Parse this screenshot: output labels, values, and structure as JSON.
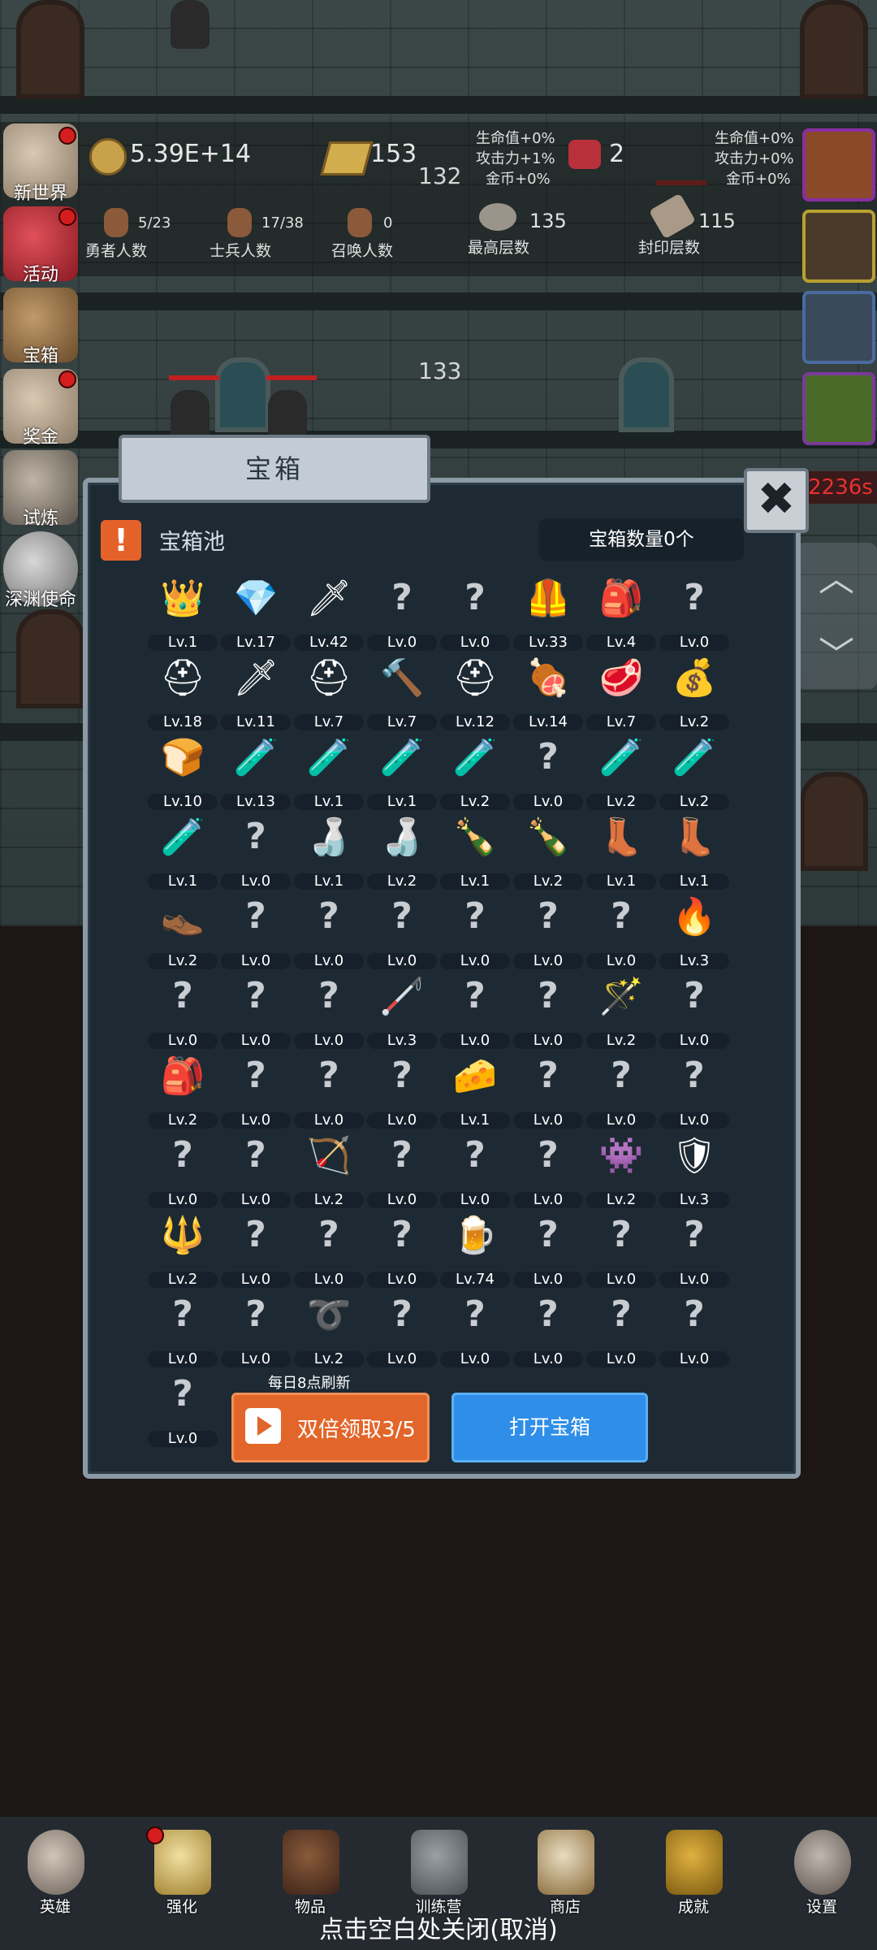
{
  "resources": {
    "gold": "5.39E+14",
    "bars": "153",
    "gems": "2",
    "mid_number": "132",
    "bonus_left": [
      "生命值+0%",
      "攻击力+1%",
      "金币+0%"
    ],
    "bonus_right": [
      "生命值+0%",
      "攻击力+0%",
      "金币+0%"
    ]
  },
  "counts": {
    "heroes_value": "5/23",
    "heroes_label": "勇者人数",
    "soldiers_value": "17/38",
    "soldiers_label": "士兵人数",
    "summon_value": "0",
    "summon_label": "召唤人数",
    "highest_value": "135",
    "highest_label": "最高层数",
    "sealed_value": "115",
    "sealed_label": "封印层数"
  },
  "floor_number": "133",
  "timer": "2236s",
  "sidebar": [
    {
      "label": "新世界"
    },
    {
      "label": "活动"
    },
    {
      "label": "宝箱"
    },
    {
      "label": "奖金"
    },
    {
      "label": "试炼"
    },
    {
      "label": "深渊使命"
    }
  ],
  "modal": {
    "title": "宝箱",
    "close_glyph": "✖",
    "pool_label": "宝箱池",
    "count_label": "宝箱数量0个",
    "refresh_note": "每日8点刷新",
    "double_button": "双倍领取3/5",
    "open_button": "打开宝箱"
  },
  "items": [
    {
      "icon": "crown-icon",
      "glyph": "👑",
      "level": "Lv.1"
    },
    {
      "icon": "diamond-icon",
      "glyph": "💎",
      "level": "Lv.17"
    },
    {
      "icon": "sword-icon",
      "glyph": "🗡",
      "level": "Lv.42"
    },
    {
      "icon": "unknown-icon",
      "glyph": "?",
      "level": "Lv.0"
    },
    {
      "icon": "unknown-icon",
      "glyph": "?",
      "level": "Lv.0"
    },
    {
      "icon": "leather-armor-icon",
      "glyph": "🦺",
      "level": "Lv.33"
    },
    {
      "icon": "backpack-icon",
      "glyph": "🎒",
      "level": "Lv.4"
    },
    {
      "icon": "unknown-icon",
      "glyph": "?",
      "level": "Lv.0"
    },
    {
      "icon": "leather-helmet-icon",
      "glyph": "⛑",
      "level": "Lv.18"
    },
    {
      "icon": "dagger-icon",
      "glyph": "🗡",
      "level": "Lv.11"
    },
    {
      "icon": "iron-helmet-icon",
      "glyph": "⛑",
      "level": "Lv.7"
    },
    {
      "icon": "hammer-icon",
      "glyph": "🔨",
      "level": "Lv.7"
    },
    {
      "icon": "knight-helmet-icon",
      "glyph": "⛑",
      "level": "Lv.12"
    },
    {
      "icon": "ham-icon",
      "glyph": "🍖",
      "level": "Lv.14"
    },
    {
      "icon": "steak-icon",
      "glyph": "🥩",
      "level": "Lv.7"
    },
    {
      "icon": "pouch-icon",
      "glyph": "💰",
      "level": "Lv.2"
    },
    {
      "icon": "bread-icon",
      "glyph": "🍞",
      "level": "Lv.10"
    },
    {
      "icon": "yellow-potion-icon",
      "glyph": "🧪",
      "level": "Lv.13"
    },
    {
      "icon": "yellow-potion-icon",
      "glyph": "🧪",
      "level": "Lv.1"
    },
    {
      "icon": "yellow-potion-icon",
      "glyph": "🧪",
      "level": "Lv.1"
    },
    {
      "icon": "red-potion-icon",
      "glyph": "🧪",
      "level": "Lv.2"
    },
    {
      "icon": "unknown-icon",
      "glyph": "?",
      "level": "Lv.0"
    },
    {
      "icon": "red-potion-icon",
      "glyph": "🧪",
      "level": "Lv.2"
    },
    {
      "icon": "blue-potion-icon",
      "glyph": "🧪",
      "level": "Lv.2"
    },
    {
      "icon": "blue-potion-icon",
      "glyph": "🧪",
      "level": "Lv.1"
    },
    {
      "icon": "unknown-icon",
      "glyph": "?",
      "level": "Lv.0"
    },
    {
      "icon": "bottle-icon",
      "glyph": "🍶",
      "level": "Lv.1"
    },
    {
      "icon": "bottle-icon",
      "glyph": "🍶",
      "level": "Lv.2"
    },
    {
      "icon": "bottle-icon",
      "glyph": "🍾",
      "level": "Lv.1"
    },
    {
      "icon": "bottle-icon",
      "glyph": "🍾",
      "level": "Lv.2"
    },
    {
      "icon": "winged-boot-icon",
      "glyph": "👢",
      "level": "Lv.1"
    },
    {
      "icon": "boot-icon",
      "glyph": "👢",
      "level": "Lv.1"
    },
    {
      "icon": "shoe-icon",
      "glyph": "👞",
      "level": "Lv.2"
    },
    {
      "icon": "unknown-icon",
      "glyph": "?",
      "level": "Lv.0"
    },
    {
      "icon": "unknown-icon",
      "glyph": "?",
      "level": "Lv.0"
    },
    {
      "icon": "unknown-icon",
      "glyph": "?",
      "level": "Lv.0"
    },
    {
      "icon": "unknown-icon",
      "glyph": "?",
      "level": "Lv.0"
    },
    {
      "icon": "unknown-icon",
      "glyph": "?",
      "level": "Lv.0"
    },
    {
      "icon": "unknown-icon",
      "glyph": "?",
      "level": "Lv.0"
    },
    {
      "icon": "torch-icon",
      "glyph": "🔥",
      "level": "Lv.3"
    },
    {
      "icon": "unknown-icon",
      "glyph": "?",
      "level": "Lv.0"
    },
    {
      "icon": "unknown-icon",
      "glyph": "?",
      "level": "Lv.0"
    },
    {
      "icon": "unknown-icon",
      "glyph": "?",
      "level": "Lv.0"
    },
    {
      "icon": "staff-icon",
      "glyph": "🦯",
      "level": "Lv.3"
    },
    {
      "icon": "unknown-icon",
      "glyph": "?",
      "level": "Lv.0"
    },
    {
      "icon": "unknown-icon",
      "glyph": "?",
      "level": "Lv.0"
    },
    {
      "icon": "magic-wand-icon",
      "glyph": "🪄",
      "level": "Lv.2"
    },
    {
      "icon": "unknown-icon",
      "glyph": "?",
      "level": "Lv.0"
    },
    {
      "icon": "backpack-icon",
      "glyph": "🎒",
      "level": "Lv.2"
    },
    {
      "icon": "unknown-icon",
      "glyph": "?",
      "level": "Lv.0"
    },
    {
      "icon": "unknown-icon",
      "glyph": "?",
      "level": "Lv.0"
    },
    {
      "icon": "unknown-icon",
      "glyph": "?",
      "level": "Lv.0"
    },
    {
      "icon": "cheese-icon",
      "glyph": "🧀",
      "level": "Lv.1"
    },
    {
      "icon": "unknown-icon",
      "glyph": "?",
      "level": "Lv.0"
    },
    {
      "icon": "unknown-icon",
      "glyph": "?",
      "level": "Lv.0"
    },
    {
      "icon": "unknown-icon",
      "glyph": "?",
      "level": "Lv.0"
    },
    {
      "icon": "unknown-icon",
      "glyph": "?",
      "level": "Lv.0"
    },
    {
      "icon": "unknown-icon",
      "glyph": "?",
      "level": "Lv.0"
    },
    {
      "icon": "bow-icon",
      "glyph": "🏹",
      "level": "Lv.2"
    },
    {
      "icon": "unknown-icon",
      "glyph": "?",
      "level": "Lv.0"
    },
    {
      "icon": "unknown-icon",
      "glyph": "?",
      "level": "Lv.0"
    },
    {
      "icon": "unknown-icon",
      "glyph": "?",
      "level": "Lv.0"
    },
    {
      "icon": "monster-card-icon",
      "glyph": "👾",
      "level": "Lv.2"
    },
    {
      "icon": "shield-emblem-icon",
      "glyph": "🛡",
      "level": "Lv.3"
    },
    {
      "icon": "crystal-scepter-icon",
      "glyph": "🔱",
      "level": "Lv.2"
    },
    {
      "icon": "unknown-icon",
      "glyph": "?",
      "level": "Lv.0"
    },
    {
      "icon": "unknown-icon",
      "glyph": "?",
      "level": "Lv.0"
    },
    {
      "icon": "unknown-icon",
      "glyph": "?",
      "level": "Lv.0"
    },
    {
      "icon": "beer-mug-icon",
      "glyph": "🍺",
      "level": "Lv.74"
    },
    {
      "icon": "unknown-icon",
      "glyph": "?",
      "level": "Lv.0"
    },
    {
      "icon": "unknown-icon",
      "glyph": "?",
      "level": "Lv.0"
    },
    {
      "icon": "unknown-icon",
      "glyph": "?",
      "level": "Lv.0"
    },
    {
      "icon": "unknown-icon",
      "glyph": "?",
      "level": "Lv.0"
    },
    {
      "icon": "unknown-icon",
      "glyph": "?",
      "level": "Lv.0"
    },
    {
      "icon": "whip-icon",
      "glyph": "➰",
      "level": "Lv.2"
    },
    {
      "icon": "unknown-icon",
      "glyph": "?",
      "level": "Lv.0"
    },
    {
      "icon": "unknown-icon",
      "glyph": "?",
      "level": "Lv.0"
    },
    {
      "icon": "unknown-icon",
      "glyph": "?",
      "level": "Lv.0"
    },
    {
      "icon": "unknown-icon",
      "glyph": "?",
      "level": "Lv.0"
    },
    {
      "icon": "unknown-icon",
      "glyph": "?",
      "level": "Lv.0"
    },
    {
      "icon": "unknown-icon",
      "glyph": "?",
      "level": "Lv.0"
    }
  ],
  "bottom_nav": [
    {
      "label": "英雄"
    },
    {
      "label": "强化"
    },
    {
      "label": "物品"
    },
    {
      "label": "训练营"
    },
    {
      "label": "商店"
    },
    {
      "label": "成就"
    },
    {
      "label": "设置"
    }
  ],
  "close_hint": "点击空白处关闭(取消)"
}
